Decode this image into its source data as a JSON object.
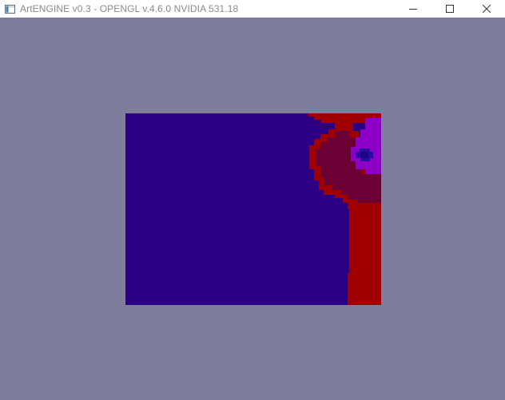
{
  "window": {
    "title": "ArtENGINE v0.3 - OPENGL v.4.6.0 NVIDIA 531.18",
    "icon": "app-window-icon",
    "caption_buttons": [
      "minimize-icon",
      "maximize-icon",
      "close-icon"
    ]
  },
  "colors": {
    "client_background": "#7e7d9b",
    "render_background": "#2b0082",
    "red": "#a10000",
    "dark_red": "#6a0034",
    "magenta": "#8c00c8",
    "blue_dot": "#2a0aa0"
  }
}
